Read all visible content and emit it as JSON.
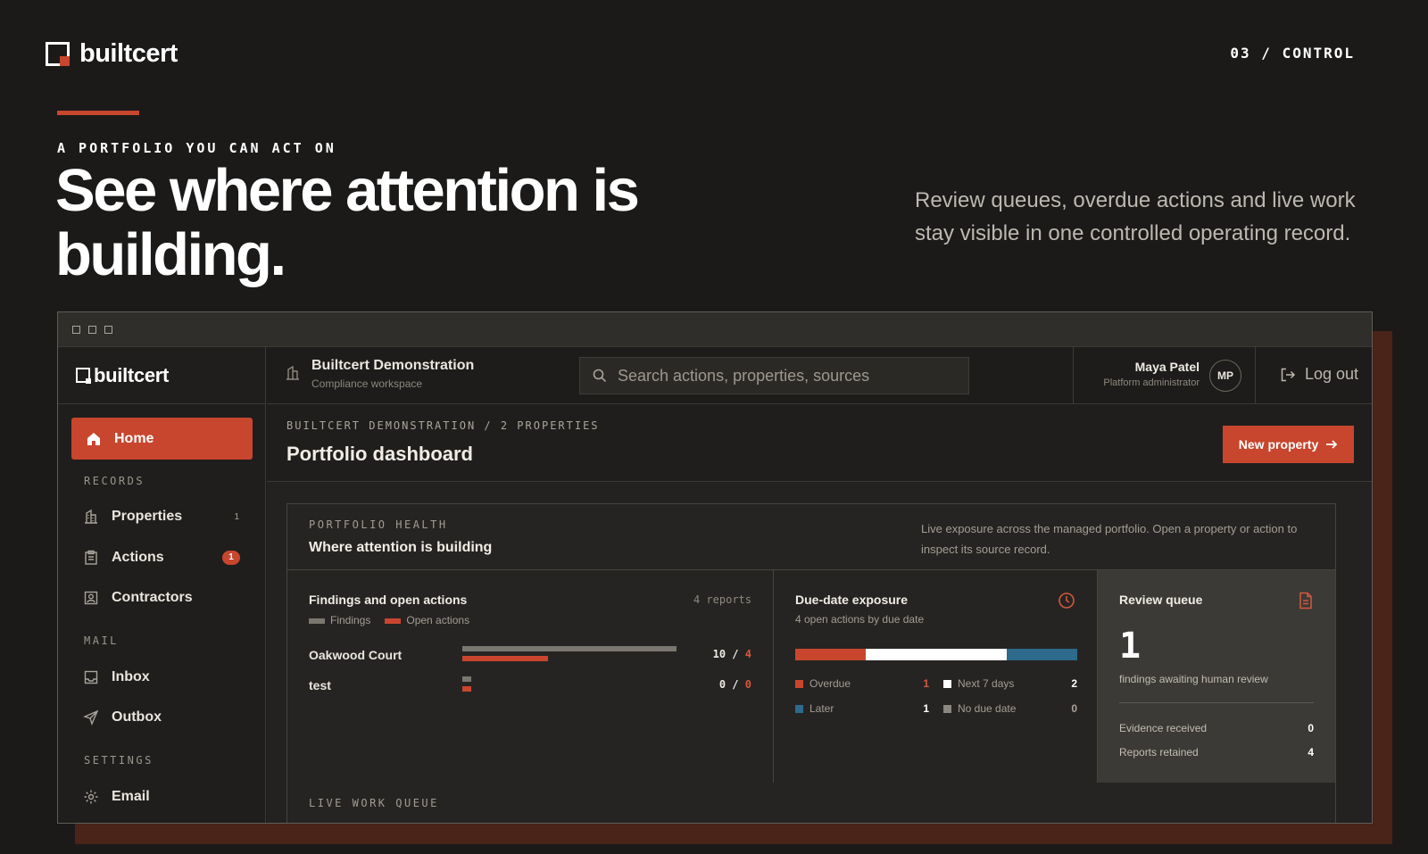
{
  "brand": {
    "name": "builtcert"
  },
  "section_label": "03 / CONTROL",
  "hero": {
    "eyebrow": "A PORTFOLIO YOU CAN ACT ON",
    "title": "See where attention is building.",
    "description": "Review queues, overdue actions and live work stay visible in one controlled operating record."
  },
  "colors": {
    "accent": "#c8462e",
    "background": "#1b1a19",
    "frame_shadow": "#4a2319",
    "blue": "#2d6a8c"
  },
  "app": {
    "brand": "builtcert",
    "workspace": {
      "name": "Builtcert Demonstration",
      "subtitle": "Compliance workspace"
    },
    "search": {
      "placeholder": "Search actions, properties, sources"
    },
    "user": {
      "name": "Maya Patel",
      "role": "Platform administrator",
      "initials": "MP"
    },
    "logout_label": "Log out",
    "sidebar": {
      "home": "Home",
      "groups": {
        "records": "RECORDS",
        "mail": "MAIL",
        "settings": "SETTINGS"
      },
      "records": [
        {
          "label": "Properties",
          "count": "1",
          "icon": "building-icon"
        },
        {
          "label": "Actions",
          "count": "1",
          "icon": "clipboard-icon",
          "alert": true
        },
        {
          "label": "Contractors",
          "count": "",
          "icon": "contact-card-icon"
        }
      ],
      "mail": [
        {
          "label": "Inbox",
          "icon": "inbox-icon"
        },
        {
          "label": "Outbox",
          "icon": "send-icon"
        }
      ],
      "settings": [
        {
          "label": "Email",
          "icon": "gear-icon"
        }
      ]
    },
    "page": {
      "breadcrumb": "BUILTCERT DEMONSTRATION / 2 PROPERTIES",
      "title": "Portfolio dashboard",
      "new_button": "New property"
    },
    "health": {
      "label": "PORTFOLIO HEALTH",
      "title": "Where attention is building",
      "description": "Live exposure across the managed portfolio. Open a property or action to inspect its source record.",
      "findings": {
        "title": "Findings and open actions",
        "meta": "4 reports",
        "legend": {
          "findings": "Findings",
          "open_actions": "Open actions"
        },
        "rows": [
          {
            "name": "Oakwood Court",
            "findings": 10,
            "open_actions": 4,
            "findings_text": "10",
            "sep": "/",
            "open_text": "4"
          },
          {
            "name": "test",
            "findings": 0,
            "open_actions": 0,
            "findings_text": "0",
            "sep": "/",
            "open_text": "0"
          }
        ],
        "max": 10
      },
      "due": {
        "title": "Due-date exposure",
        "subtitle": "4 open actions by due date",
        "segments": [
          {
            "label": "Overdue",
            "value": 1,
            "value_text": "1",
            "color": "#c8462e"
          },
          {
            "label": "Next 7 days",
            "value": 2,
            "value_text": "2",
            "color": "#ffffff"
          },
          {
            "label": "Later",
            "value": 1,
            "value_text": "1",
            "color": "#2d6a8c"
          },
          {
            "label": "No due date",
            "value": 0,
            "value_text": "0",
            "color": "#8a8680"
          }
        ]
      },
      "review": {
        "title": "Review queue",
        "count": "1",
        "subtitle": "findings awaiting human review",
        "rows": [
          {
            "label": "Evidence received",
            "value": "0"
          },
          {
            "label": "Reports retained",
            "value": "4"
          }
        ]
      }
    },
    "live_work_label": "LIVE WORK QUEUE"
  }
}
